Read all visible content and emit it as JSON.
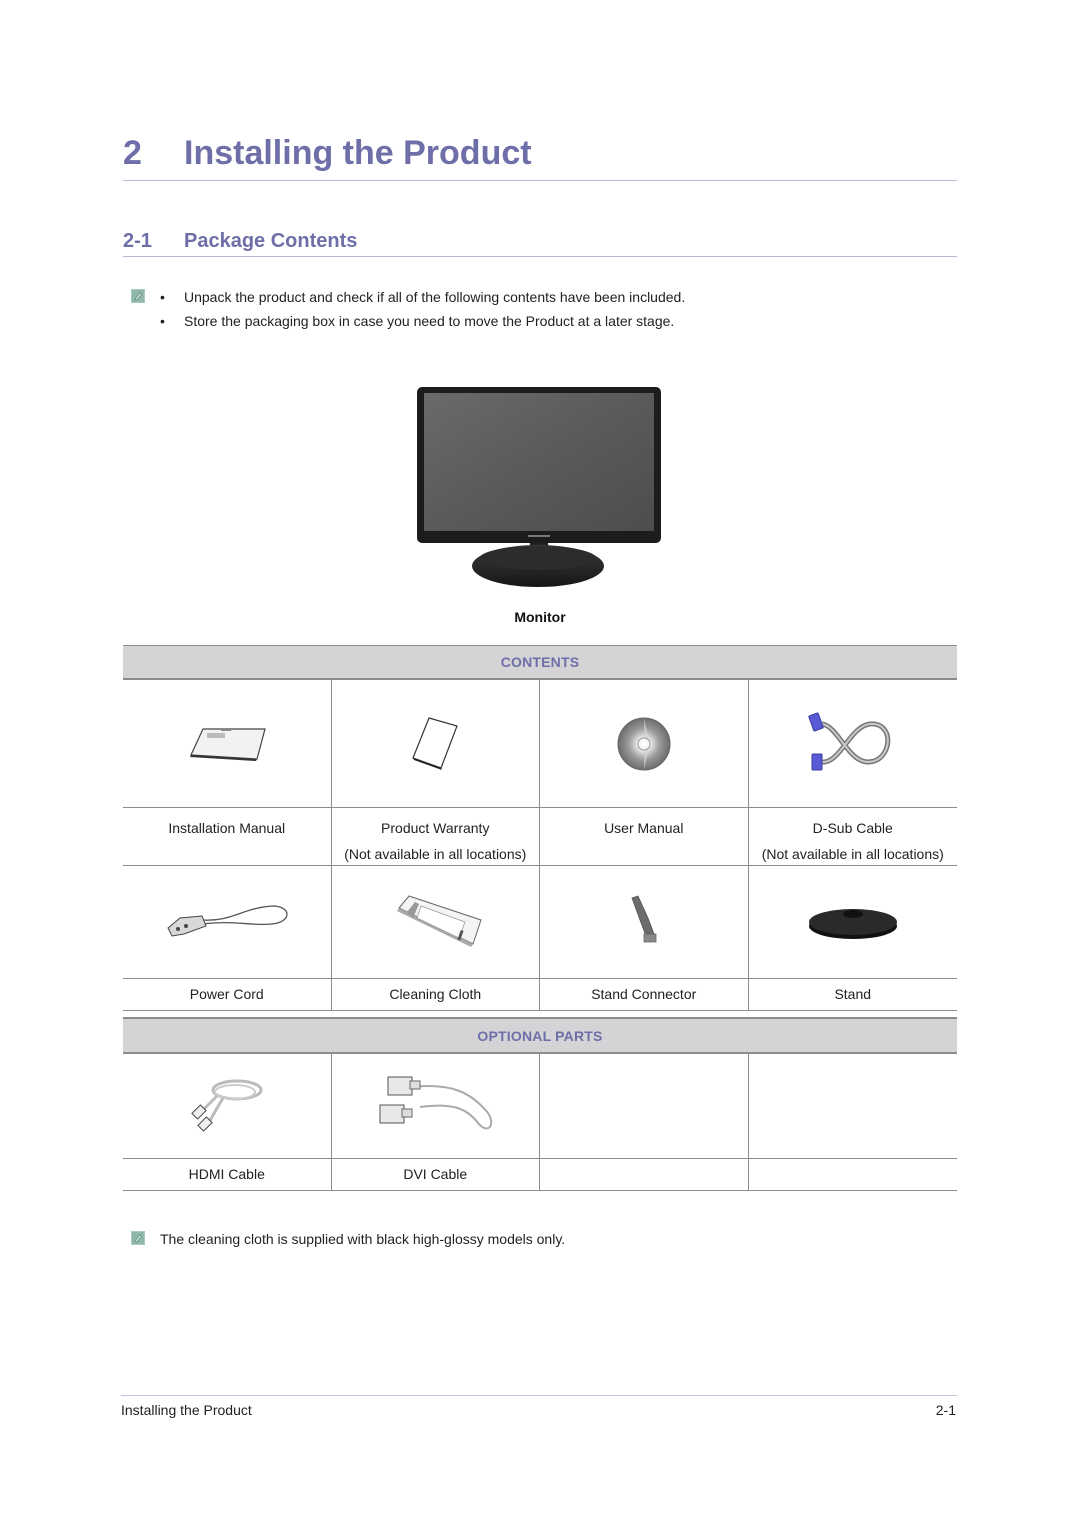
{
  "chapter": {
    "number": "2",
    "title": "Installing the Product"
  },
  "section": {
    "number": "2-1",
    "title": "Package Contents"
  },
  "intro_note": {
    "icon": "note-icon",
    "bullets": [
      "Unpack the product and check if all of the following contents have been included.",
      "Store the packaging box in case you need to move the Product at a later stage."
    ]
  },
  "monitor": {
    "image": "monitor-image",
    "caption": "Monitor"
  },
  "contents_table": {
    "header": "CONTENTS",
    "rows": [
      [
        {
          "icon": "installation-manual-image",
          "label": "Installation Manual",
          "sublabel": ""
        },
        {
          "icon": "product-warranty-image",
          "label": "Product Warranty",
          "sublabel": "(Not available in all locations)"
        },
        {
          "icon": "user-manual-cd-image",
          "label": "User Manual",
          "sublabel": ""
        },
        {
          "icon": "dsub-cable-image",
          "label": "D-Sub Cable",
          "sublabel": "(Not available in all locations)"
        }
      ],
      [
        {
          "icon": "power-cord-image",
          "label": "Power Cord",
          "sublabel": ""
        },
        {
          "icon": "cleaning-cloth-image",
          "label": "Cleaning Cloth",
          "sublabel": ""
        },
        {
          "icon": "stand-connector-image",
          "label": "Stand Connector",
          "sublabel": ""
        },
        {
          "icon": "stand-image",
          "label": "Stand",
          "sublabel": ""
        }
      ]
    ]
  },
  "optional_table": {
    "header": "OPTIONAL PARTS",
    "rows": [
      [
        {
          "icon": "hdmi-cable-image",
          "label": "HDMI Cable"
        },
        {
          "icon": "dvi-cable-image",
          "label": "DVI Cable"
        },
        {
          "icon": "",
          "label": ""
        },
        {
          "icon": "",
          "label": ""
        }
      ]
    ]
  },
  "footer_note": {
    "icon": "note-icon",
    "text": "The cleaning cloth is supplied with black high-glossy models only."
  },
  "page_footer": {
    "left": "Installing the Product",
    "right": "2-1"
  },
  "colors": {
    "heading": "#6e6ea8",
    "table_header_bg": "#d4d4d6",
    "rule": "#b8b8d4",
    "note_icon": "#8fb8aa"
  }
}
